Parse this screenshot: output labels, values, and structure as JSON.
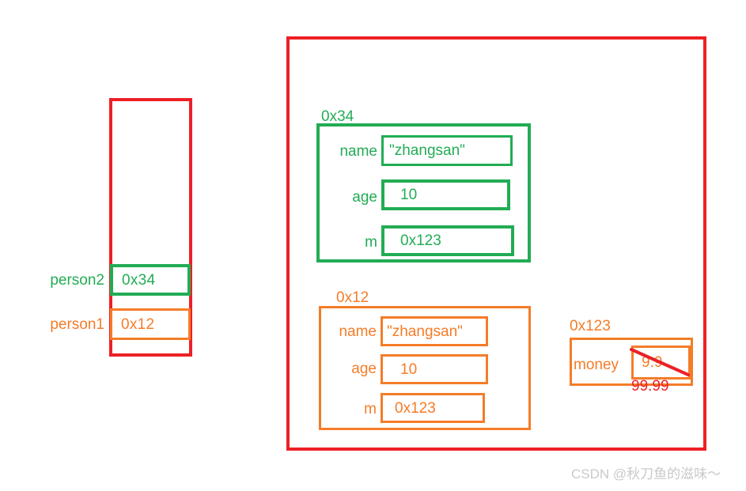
{
  "colors": {
    "red": "#EC2025",
    "green": "#22AC54",
    "orange": "#F57C28",
    "watermark_gray": "#c9c9c9",
    "background": "#ffffff"
  },
  "diagram": {
    "type": "memory-layout-diagram",
    "stack": {
      "slots": [
        {
          "label": "person2",
          "value": "0x34",
          "color": "#22AC54"
        },
        {
          "label": "person1",
          "value": "0x12",
          "color": "#F57C28"
        }
      ]
    },
    "heap": {
      "objects": [
        {
          "address": "0x34",
          "color": "#22AC54",
          "fields": [
            {
              "name": "name",
              "value": "\"zhangsan\""
            },
            {
              "name": "age",
              "value": "10"
            },
            {
              "name": "m",
              "value": "0x123"
            }
          ]
        },
        {
          "address": "0x12",
          "color": "#F57C28",
          "fields": [
            {
              "name": "name",
              "value": "\"zhangsan\""
            },
            {
              "name": "age",
              "value": "10"
            },
            {
              "name": "m",
              "value": "0x123"
            }
          ]
        },
        {
          "address": "0x123",
          "color": "#F57C28",
          "fields": [
            {
              "name": "money",
              "value": "9.9",
              "struck_out": true,
              "new_value": "99.99"
            }
          ]
        }
      ]
    }
  },
  "watermark": {
    "text": "CSDN @秋刀鱼的滋味～"
  }
}
